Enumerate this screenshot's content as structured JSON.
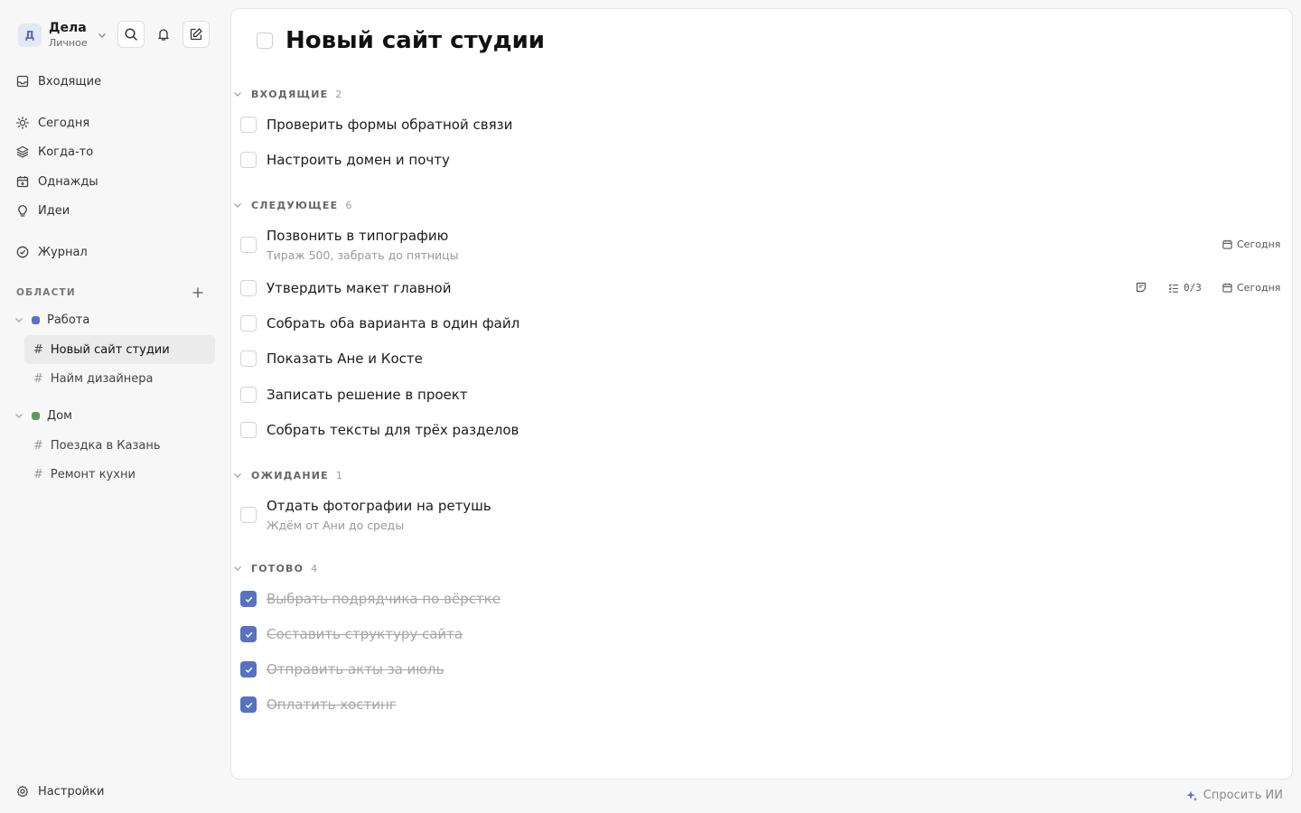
{
  "workspace": {
    "avatar": "Д",
    "title": "Дела",
    "subtitle": "Личное"
  },
  "icons": {
    "search": "search-icon",
    "bell": "bell-icon",
    "compose": "pencil-square-icon"
  },
  "nav": {
    "inbox": "Входящие",
    "today": "Сегодня",
    "someday": "Когда-то",
    "once": "Однажды",
    "ideas": "Идеи",
    "journal": "Журнал",
    "settings": "Настройки"
  },
  "areas_label": "ОБЛАСТИ",
  "areas": [
    {
      "name": "Работа",
      "color": "#5b73c2",
      "projects": [
        "Новый сайт студии",
        "Найм дизайнера"
      ]
    },
    {
      "name": "Дом",
      "color": "#5e9a5c",
      "projects": [
        "Поездка в Казань",
        "Ремонт кухни"
      ]
    }
  ],
  "main": {
    "title": "Новый сайт студии",
    "groups": [
      {
        "name": "ВХОДЯЩИЕ",
        "count": "2",
        "tasks": [
          {
            "title": "Проверить формы обратной связи"
          },
          {
            "title": "Настроить домен и почту"
          }
        ]
      },
      {
        "name": "СЛЕДУЮЩЕЕ",
        "count": "6",
        "tasks": [
          {
            "title": "Позвонить в типографию",
            "note": "Тираж 500, забрать до пятницы",
            "due": "Сегодня"
          },
          {
            "title": "Утвердить макет главной",
            "checklist": "0/3",
            "due": "Сегодня",
            "has_note": true
          },
          {
            "title": "Собрать оба варианта в один файл"
          },
          {
            "title": "Показать Ане и Косте"
          },
          {
            "title": "Записать решение в проект"
          },
          {
            "title": "Собрать тексты для трёх разделов"
          }
        ]
      },
      {
        "name": "ОЖИДАНИЕ",
        "count": "1",
        "tasks": [
          {
            "title": "Отдать фотографии на ретушь",
            "note": "Ждём от Ани до среды"
          }
        ]
      },
      {
        "name": "ГОТОВО",
        "count": "4",
        "tasks": [
          {
            "title": "Выбрать подрядчика по вёрстке",
            "done": true
          },
          {
            "title": "Составить структуру сайта",
            "done": true
          },
          {
            "title": "Отправить акты за июль",
            "done": true
          },
          {
            "title": "Оплатить хостинг",
            "done": true
          }
        ]
      }
    ]
  },
  "ai_button": "Спросить ИИ",
  "colors": {
    "accent": "#5672c0"
  }
}
